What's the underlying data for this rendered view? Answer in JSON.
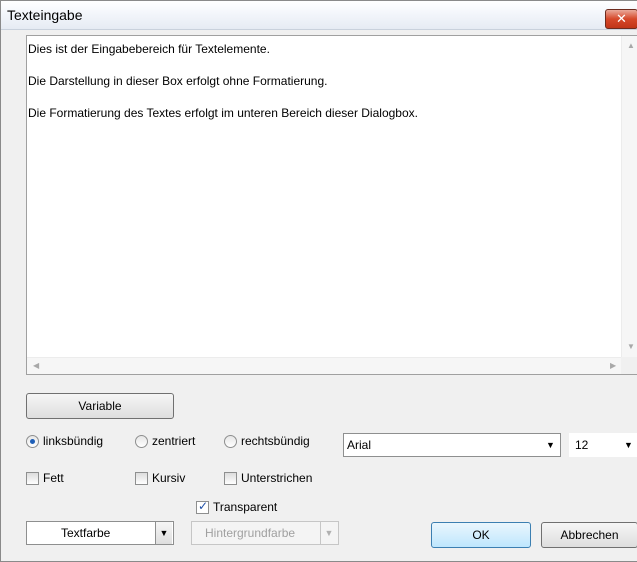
{
  "window": {
    "title": "Texteingabe",
    "close_glyph": "✕"
  },
  "editor": {
    "lines": [
      "Dies ist der Eingabebereich für Textelemente.",
      "Die Darstellung in dieser Box erfolgt ohne Formatierung.",
      "Die Formatierung des Textes erfolgt im unteren Bereich dieser Dialogbox."
    ]
  },
  "buttons": {
    "variable": "Variable",
    "ok": "OK",
    "cancel": "Abbrechen"
  },
  "alignment": {
    "selected": "linksbündig",
    "options": [
      "linksbündig",
      "zentriert",
      "rechtsbündig"
    ]
  },
  "font": {
    "family": "Arial",
    "size": "12"
  },
  "style": {
    "bold": "Fett",
    "italic": "Kursiv",
    "underline": "Unterstrichen"
  },
  "transparent": {
    "label": "Transparent",
    "checked": true
  },
  "color": {
    "text": "Textfarbe",
    "background": "Hintergrundfarbe"
  }
}
